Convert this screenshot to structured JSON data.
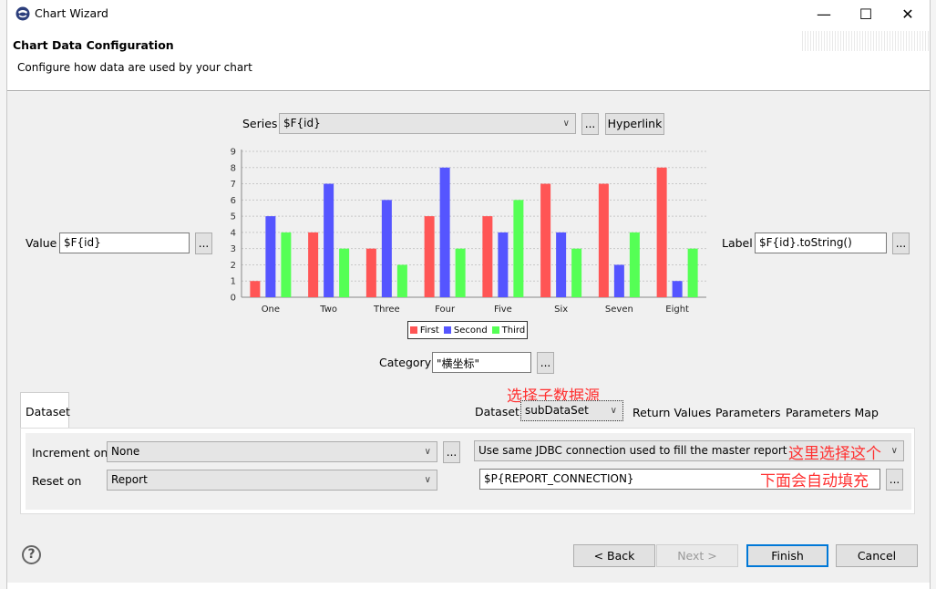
{
  "window": {
    "title": "Chart Wizard",
    "minimize": "—",
    "maximize": "☐",
    "close": "✕"
  },
  "header": {
    "title": "Chart Data Configuration",
    "description": "Configure how data are used by your chart"
  },
  "series": {
    "label": "Series",
    "value": "$F{id}",
    "more": "...",
    "hyperlink": "Hyperlink"
  },
  "value_field": {
    "label": "Value",
    "value": "$F{id}",
    "more": "..."
  },
  "label_field": {
    "label": "Label",
    "value": "$F{id}.toString()",
    "more": "..."
  },
  "category": {
    "label": "Category",
    "value": "\"横坐标\"",
    "more": "..."
  },
  "chart_data": {
    "type": "bar",
    "categories": [
      "One",
      "Two",
      "Three",
      "Four",
      "Five",
      "Six",
      "Seven",
      "Eight"
    ],
    "series": [
      {
        "name": "First",
        "color": "#ff5555",
        "values": [
          1,
          4,
          3,
          5,
          5,
          7,
          7,
          8
        ]
      },
      {
        "name": "Second",
        "color": "#5555ff",
        "values": [
          5,
          7,
          6,
          8,
          4,
          4,
          2,
          1
        ]
      },
      {
        "name": "Third",
        "color": "#55ff55",
        "values": [
          4,
          3,
          2,
          3,
          6,
          3,
          4,
          3
        ]
      }
    ],
    "ylim": [
      0,
      9
    ],
    "yticks": [
      0,
      1,
      2,
      3,
      4,
      5,
      6,
      7,
      8,
      9
    ],
    "grid": true,
    "legend": "bottom"
  },
  "tabs": {
    "dataset": "Dataset",
    "return_values": "Return Values",
    "parameters": "Parameters",
    "parameters_map": "Parameters Map"
  },
  "dataset_select": {
    "label": "Dataset",
    "value": "subDataSet"
  },
  "increment": {
    "label": "Increment on",
    "value": "None",
    "more": "..."
  },
  "reset": {
    "label": "Reset on",
    "value": "Report"
  },
  "connection": {
    "value": "Use same JDBC connection used to fill the master report",
    "expression": "$P{REPORT_CONNECTION}",
    "more": "..."
  },
  "annotations": {
    "select_subdataset": "选择子数据源",
    "select_here": "这里选择这个",
    "auto_fill": "下面会自动填充"
  },
  "footer": {
    "help": "?",
    "back": "< Back",
    "next": "Next >",
    "finish": "Finish",
    "cancel": "Cancel"
  }
}
